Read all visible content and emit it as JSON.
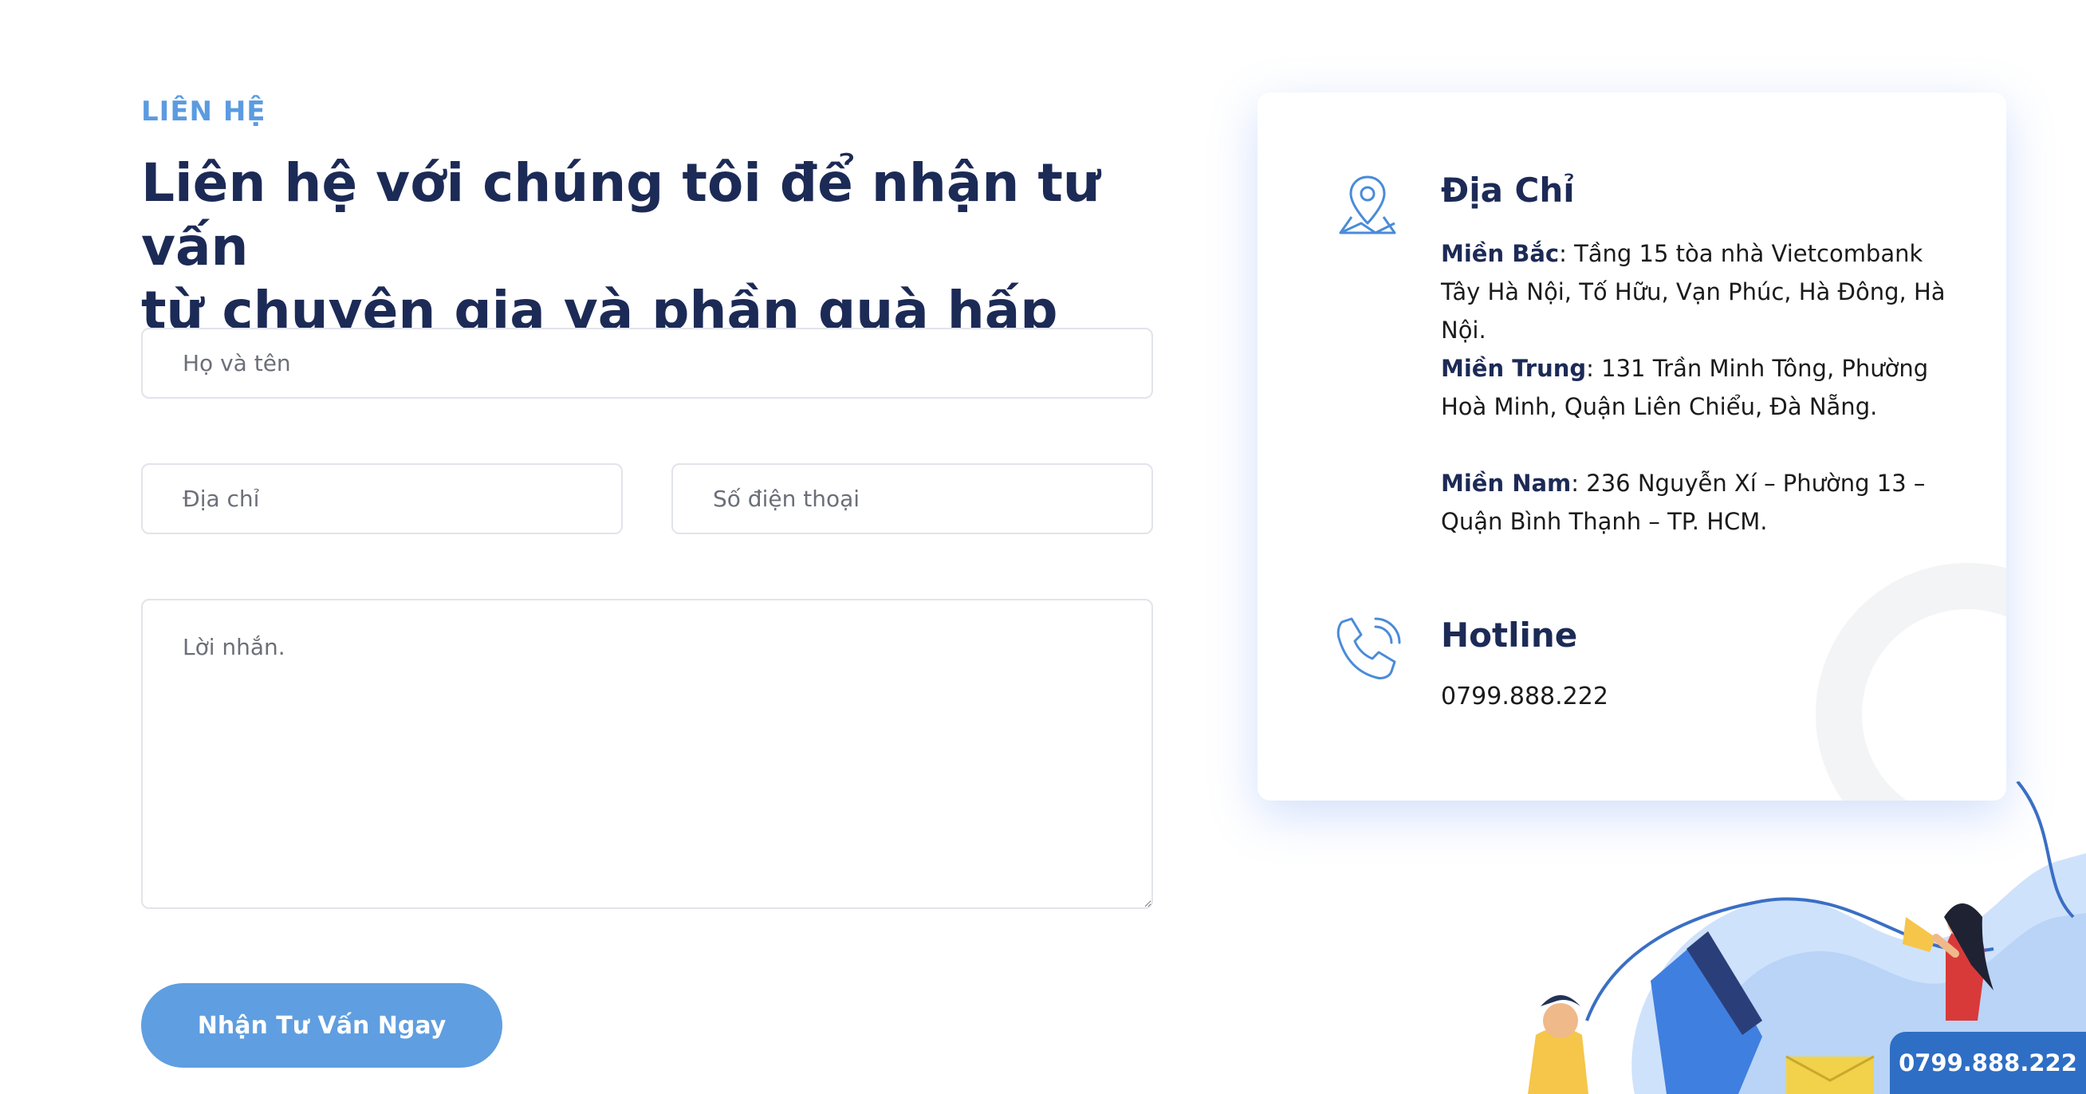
{
  "section": {
    "kicker": "LIÊN HỆ",
    "heading_line1": "Liên hệ với chúng tôi để nhận tư vấn",
    "heading_line2": "từ chuyên gia và phần quà hấp dẫn"
  },
  "form": {
    "name_placeholder": "Họ và tên",
    "address_placeholder": "Địa chỉ",
    "phone_placeholder": "Số điện thoại",
    "message_placeholder": "Lời nhắn.",
    "submit_label": "Nhận Tư Vấn Ngay"
  },
  "contact": {
    "address_title": "Địa Chỉ",
    "offices": [
      {
        "region": "Miền Bắc",
        "address": ": Tầng 15 tòa nhà Vietcombank Tây Hà Nội, Tố Hữu, Vạn Phúc, Hà Đông, Hà Nội."
      },
      {
        "region": "Miền Trung",
        "address": ": 131 Trần Minh Tông, Phường Hoà Minh, Quận Liên Chiểu, Đà Nẵng."
      },
      {
        "region": "Miền Nam",
        "address": ": 236 Nguyễn Xí – Phường 13 – Quận Bình Thạnh – TP. HCM."
      }
    ],
    "hotline_title": "Hotline",
    "hotline_number": "0799.888.222"
  },
  "floating": {
    "phone": "0799.888.222"
  },
  "colors": {
    "accent": "#5b9be0",
    "heading": "#1c2a56",
    "button": "#5f9ee0",
    "floating_bar": "#2e6ec4"
  },
  "icons": [
    "map-pin-icon",
    "phone-icon"
  ]
}
